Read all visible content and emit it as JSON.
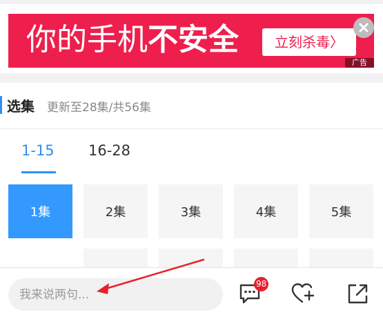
{
  "ad": {
    "headline_light": "你的手机",
    "headline_bold": "不安全",
    "cta_label": "立刻杀毒〉",
    "tag": "广告",
    "close_icon": "close-icon",
    "colors": {
      "banner": "#ee1f4d",
      "text": "#ffffff"
    }
  },
  "episodes": {
    "section_title": "选集",
    "subtitle": "更新至28集/共56集",
    "range_tabs": [
      {
        "label": "1-15",
        "active": true
      },
      {
        "label": "16-28",
        "active": false
      }
    ],
    "items": [
      "1集",
      "2集",
      "3集",
      "4集",
      "5集"
    ],
    "selected_index": 0,
    "accent_color": "#3399ff"
  },
  "toolbar": {
    "comment_placeholder": "我来说两句...",
    "comment_icon": "comment-icon",
    "comment_count": "98",
    "favorite_icon": "heart-plus-icon",
    "share_icon": "share-icon",
    "badge_color": "#e8202e"
  }
}
